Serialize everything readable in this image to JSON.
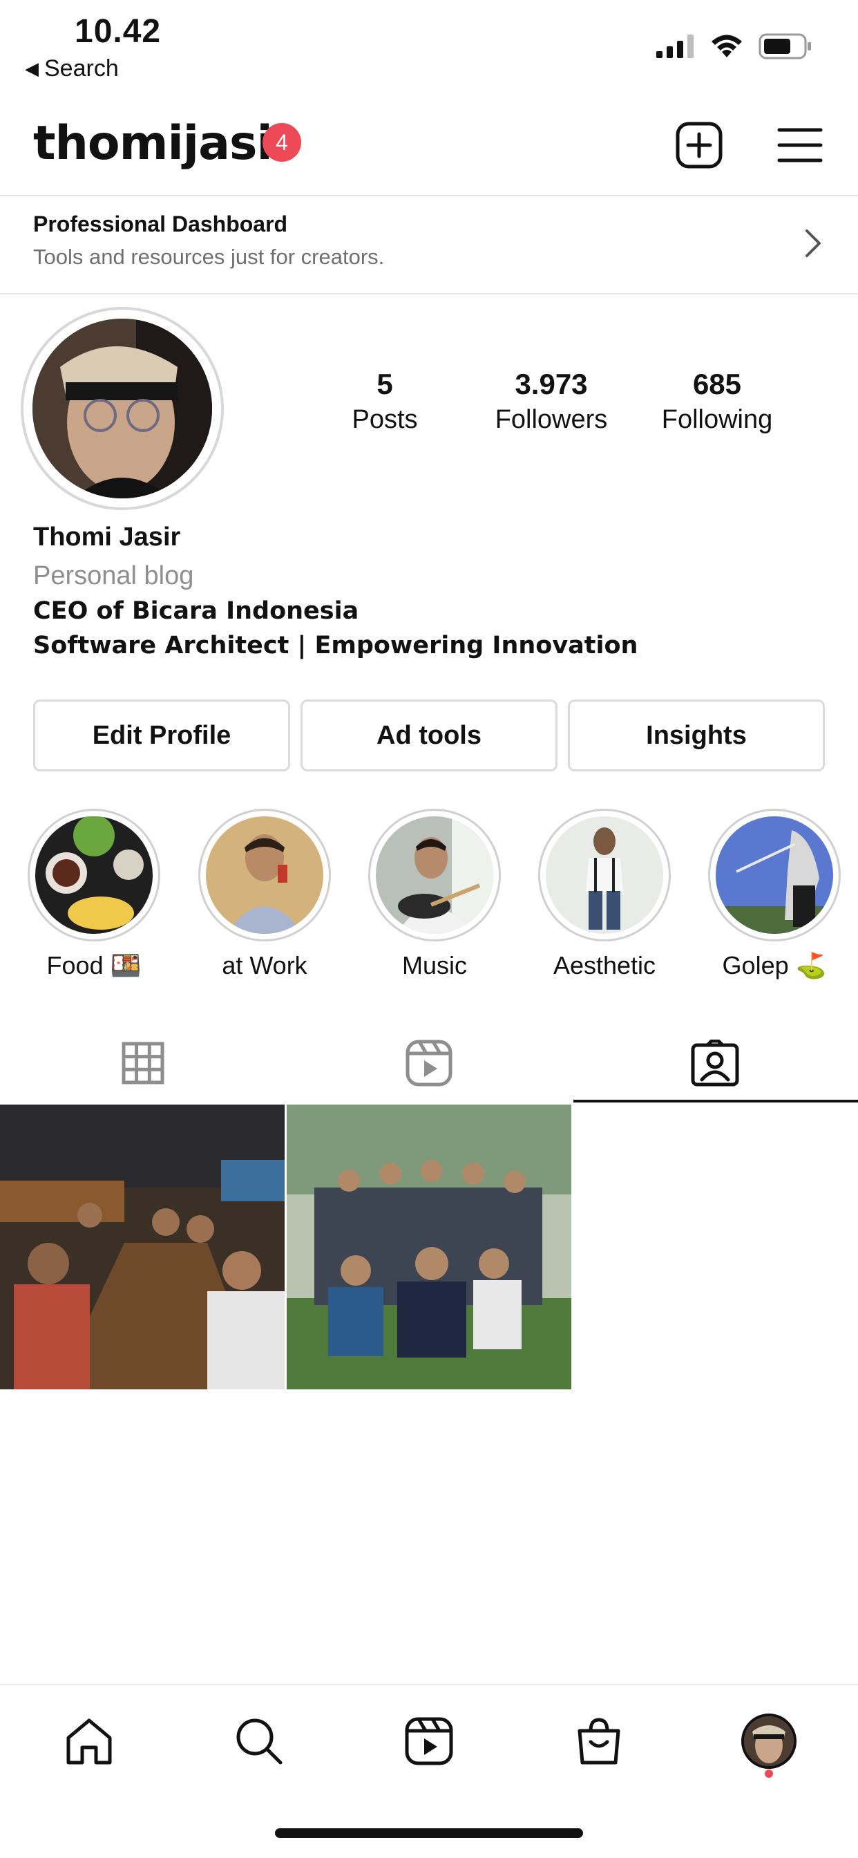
{
  "status_bar": {
    "time": "10.42",
    "back_label": "Search"
  },
  "header": {
    "username": "thomijasir",
    "notification_count": "4"
  },
  "dashboard": {
    "title": "Professional Dashboard",
    "subtitle": "Tools and resources just for creators."
  },
  "profile": {
    "stats": [
      {
        "value": "5",
        "label": "Posts"
      },
      {
        "value": "3.973",
        "label": "Followers"
      },
      {
        "value": "685",
        "label": "Following"
      }
    ],
    "full_name": "Thomi Jasir",
    "category": "Personal blog",
    "bio_lines": [
      "CEO of Bicara Indonesia",
      "Software Architect | Empowering Innovation"
    ]
  },
  "actions": {
    "edit_profile": "Edit Profile",
    "ad_tools": "Ad tools",
    "insights": "Insights"
  },
  "highlights": [
    {
      "label": "Food 🍱"
    },
    {
      "label": "at Work"
    },
    {
      "label": "Music"
    },
    {
      "label": "Aesthetic"
    },
    {
      "label": "Golep ⛳"
    }
  ],
  "tabs": {
    "active": "tagged",
    "items": [
      "grid-icon",
      "reels-icon",
      "tagged-icon"
    ]
  },
  "colors": {
    "badge": "#ed4956",
    "border": "#dbdbdb",
    "muted": "#8e8e8e"
  }
}
